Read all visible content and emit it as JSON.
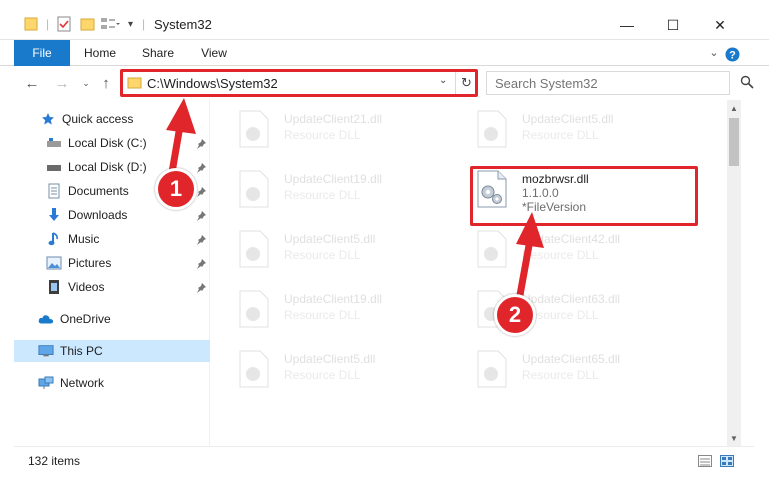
{
  "window": {
    "title": "System32",
    "minimize": "—",
    "maximize": "☐",
    "close": "✕"
  },
  "ribbon": {
    "tabs": [
      "File",
      "Home",
      "Share",
      "View"
    ]
  },
  "address": {
    "path": "C:\\Windows\\System32",
    "search_placeholder": "Search System32"
  },
  "sidebar": {
    "items": [
      {
        "label": "Quick access",
        "icon": "star-icon",
        "pinned": false
      },
      {
        "label": "Local Disk (C:)",
        "icon": "drive-icon",
        "pinned": true
      },
      {
        "label": "Local Disk (D:)",
        "icon": "drive-icon",
        "pinned": true
      },
      {
        "label": "Documents",
        "icon": "documents-icon",
        "pinned": true
      },
      {
        "label": "Downloads",
        "icon": "download-arrow-icon",
        "pinned": true
      },
      {
        "label": "Music",
        "icon": "music-note-icon",
        "pinned": true
      },
      {
        "label": "Pictures",
        "icon": "pictures-icon",
        "pinned": true
      },
      {
        "label": "Videos",
        "icon": "film-icon",
        "pinned": true
      },
      {
        "label": "OneDrive",
        "icon": "cloud-icon",
        "pinned": false
      },
      {
        "label": "This PC",
        "icon": "monitor-icon",
        "pinned": false,
        "selected": true
      },
      {
        "label": "Network",
        "icon": "network-icon",
        "pinned": false
      }
    ]
  },
  "files": [
    {
      "name": "UpdateClient21.dll",
      "desc": "Resource DLL"
    },
    {
      "name": "UpdateClient5.dll",
      "desc": "Resource DLL"
    },
    {
      "name": "UpdateClient19.dll",
      "desc": "Resource DLL"
    },
    {
      "name": "UpdateClient5.dll",
      "desc": "Resource DLL"
    },
    {
      "name": "UpdateClient42.dll",
      "desc": "Resource DLL"
    },
    {
      "name": "UpdateClient19.dll",
      "desc": "Resource DLL"
    },
    {
      "name": "UpdateClient63.dll",
      "desc": "Resource DLL"
    },
    {
      "name": "UpdateClient5.dll",
      "desc": "Resource DLL"
    },
    {
      "name": "UpdateClient65.dll",
      "desc": "Resource DLL"
    }
  ],
  "focus_file": {
    "name": "mozbrwsr.dll",
    "version": "1.1.0.0",
    "type": "*FileVersion"
  },
  "status": {
    "item_count": "132 items"
  },
  "badges": [
    "1",
    "2"
  ],
  "colors": {
    "accent": "#1979ca",
    "highlight": "#e0262b",
    "selected": "#cce8ff"
  }
}
